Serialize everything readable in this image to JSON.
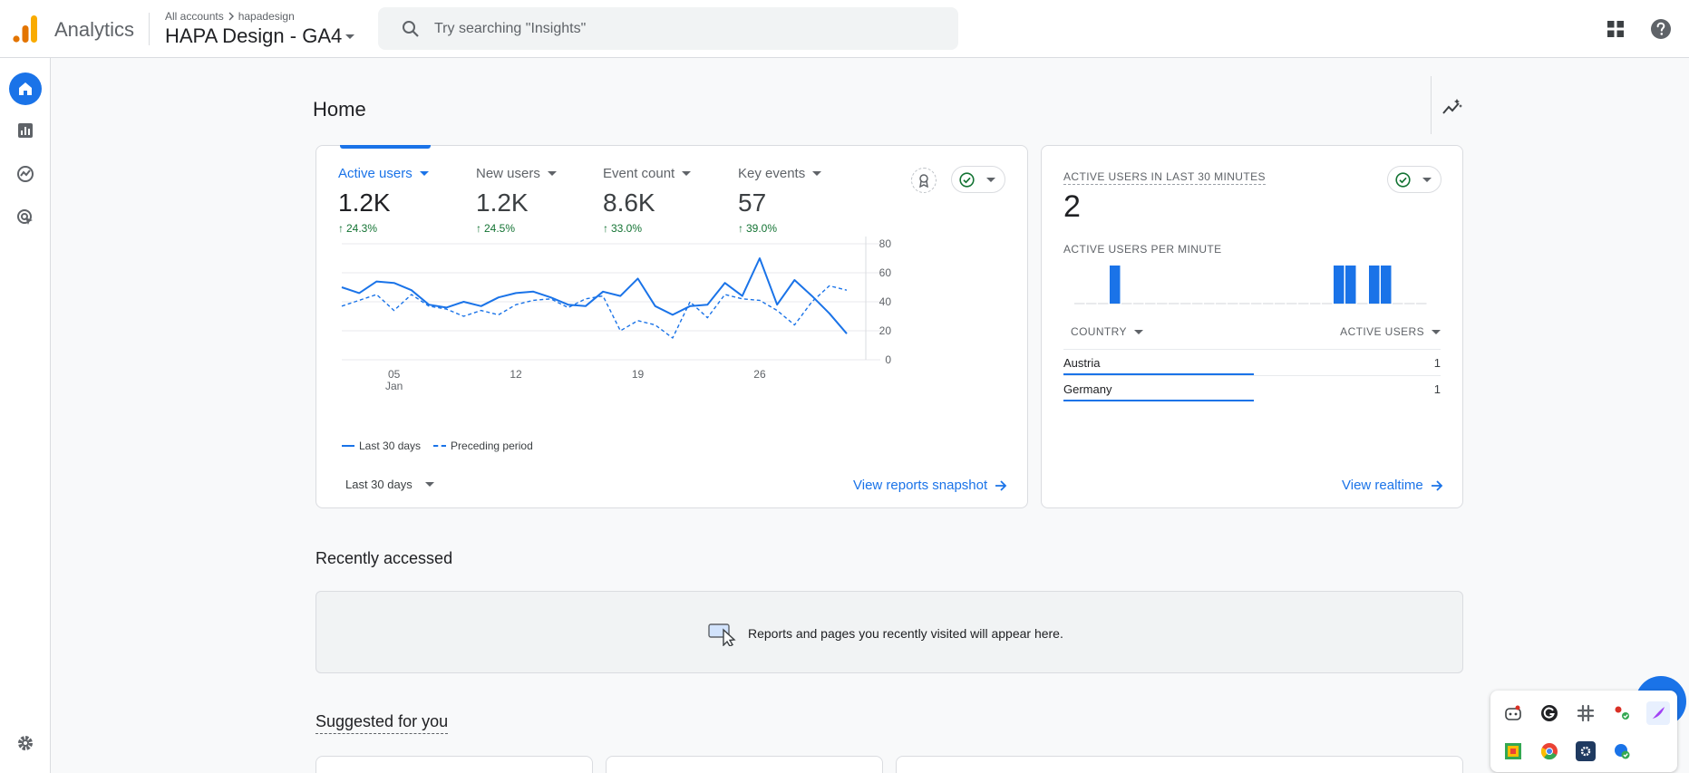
{
  "app": {
    "name": "Analytics"
  },
  "account": {
    "breadcrumb_root": "All accounts",
    "breadcrumb_child": "hapadesign",
    "property": "HAPA Design - GA4"
  },
  "search": {
    "placeholder": "Try searching \"Insights\""
  },
  "icons": {
    "logo": "analytics-logo-icon",
    "search": "search-icon",
    "apps": "apps-grid-icon",
    "help": "help-icon",
    "rail": [
      "home-icon",
      "reports-icon",
      "explore-icon",
      "advertising-icon",
      "settings-icon"
    ],
    "insights": "insights-icon"
  },
  "colors": {
    "accent": "#1a73e8",
    "positive": "#137333",
    "logo_orange": "#f9ab00",
    "logo_dark": "#e37400"
  },
  "page": {
    "title": "Home"
  },
  "metrics": [
    {
      "label": "Active users",
      "value": "1.2K",
      "change": "24.3%"
    },
    {
      "label": "New users",
      "value": "1.2K",
      "change": "24.5%"
    },
    {
      "label": "Event count",
      "value": "8.6K",
      "change": "33.0%"
    },
    {
      "label": "Key events",
      "value": "57",
      "change": "39.0%"
    }
  ],
  "chart_data": {
    "type": "line",
    "x": [
      1,
      2,
      3,
      4,
      5,
      6,
      7,
      8,
      9,
      10,
      11,
      12,
      13,
      14,
      15,
      16,
      17,
      18,
      19,
      20,
      21,
      22,
      23,
      24,
      25,
      26,
      27,
      28,
      29,
      30
    ],
    "x_ticks": [
      {
        "x": 4,
        "label": "05",
        "sublabel": "Jan"
      },
      {
        "x": 11,
        "label": "12"
      },
      {
        "x": 18,
        "label": "19"
      },
      {
        "x": 25,
        "label": "26"
      }
    ],
    "ylim": [
      0,
      80
    ],
    "y_ticks": [
      0,
      20,
      40,
      60,
      80
    ],
    "grid": true,
    "legend_position": "bottom-left",
    "series": [
      {
        "name": "Last 30 days",
        "style": "solid",
        "values": [
          50,
          46,
          54,
          53,
          48,
          38,
          36,
          40,
          37,
          43,
          46,
          47,
          43,
          38,
          37,
          47,
          44,
          56,
          37,
          31,
          37,
          38,
          53,
          44,
          70,
          38,
          55,
          44,
          32,
          18
        ]
      },
      {
        "name": "Preceding period",
        "style": "dashed",
        "values": [
          37,
          41,
          45,
          34,
          45,
          37,
          35,
          30,
          34,
          31,
          38,
          41,
          42,
          36,
          42,
          44,
          20,
          27,
          24,
          15,
          40,
          29,
          45,
          42,
          41,
          34,
          24,
          40,
          51,
          48
        ]
      }
    ]
  },
  "main_card": {
    "date_range": "Last 30 days",
    "view_link": "View reports snapshot"
  },
  "realtime": {
    "title": "ACTIVE USERS IN LAST 30 MINUTES",
    "value": "2",
    "sub_title": "ACTIVE USERS PER MINUTE",
    "per_minute": [
      0,
      0,
      0,
      1,
      0,
      0,
      0,
      0,
      0,
      0,
      0,
      0,
      0,
      0,
      0,
      0,
      0,
      0,
      0,
      0,
      0,
      0,
      1,
      1,
      0,
      1,
      1,
      0,
      0,
      0
    ],
    "col_country": "COUNTRY",
    "col_users": "ACTIVE USERS",
    "rows": [
      {
        "country": "Austria",
        "users": "1"
      },
      {
        "country": "Germany",
        "users": "1"
      }
    ],
    "view_link": "View realtime"
  },
  "recent": {
    "title": "Recently accessed",
    "message": "Reports and pages you recently visited will appear here."
  },
  "suggested": {
    "title": "Suggested for you"
  },
  "tray": {
    "icons": [
      "chat-bot-icon",
      "grammarly-icon",
      "slack-icon",
      "status-dots-icon",
      "quill-icon",
      "color-grid-icon",
      "chrome-icon",
      "gear-square-icon",
      "shield-check-icon"
    ]
  }
}
